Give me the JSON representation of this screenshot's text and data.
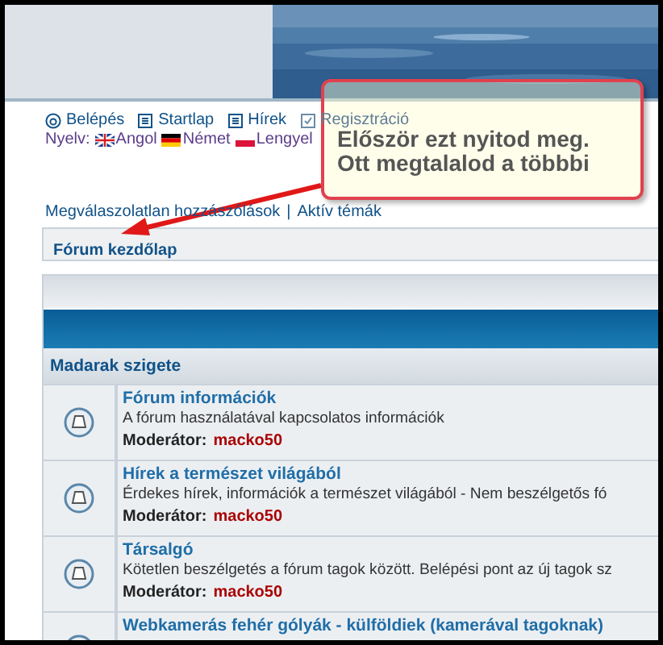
{
  "nav": {
    "links": [
      {
        "label": "Belépés",
        "kind": "login"
      },
      {
        "label": "Startlap",
        "kind": "page"
      },
      {
        "label": "Hírek",
        "kind": "page"
      },
      {
        "label": "Regisztráció",
        "kind": "register"
      }
    ],
    "language_label": "Nyelv:",
    "languages": [
      {
        "label": "Angol",
        "kind": "uk"
      },
      {
        "label": "Német",
        "kind": "de"
      },
      {
        "label": "Lengyel",
        "kind": "pl"
      }
    ]
  },
  "quick_links": [
    "Megválaszolatlan hozzászólások",
    "|",
    "Aktív témák"
  ],
  "breadcrumb": "Fórum kezdőlap",
  "category": "Madarak szigete",
  "forums": [
    {
      "title": "Fórum információk",
      "description": "A fórum használatával kapcsolatos információk",
      "moderator_label": "Moderátor:",
      "moderator": "macko50"
    },
    {
      "title": "Hírek a természet világából",
      "description": "Érdekes hírek, információk a természet világából - Nem beszélgetős fó",
      "moderator_label": "Moderátor:",
      "moderator": "macko50"
    },
    {
      "title": "Társalgó",
      "description": "Kötetlen beszélgetés a fórum tagok között. Belépési pont az új tagok sz",
      "moderator_label": "Moderátor:",
      "moderator": "macko50"
    },
    {
      "title": "Webkamerás fehér gólyák - külföldiek (kamerával tagoknak)"
    }
  ],
  "callout": {
    "lines": [
      "Először ezt nyitod meg.",
      "Ott megtalalod a többbi"
    ]
  }
}
